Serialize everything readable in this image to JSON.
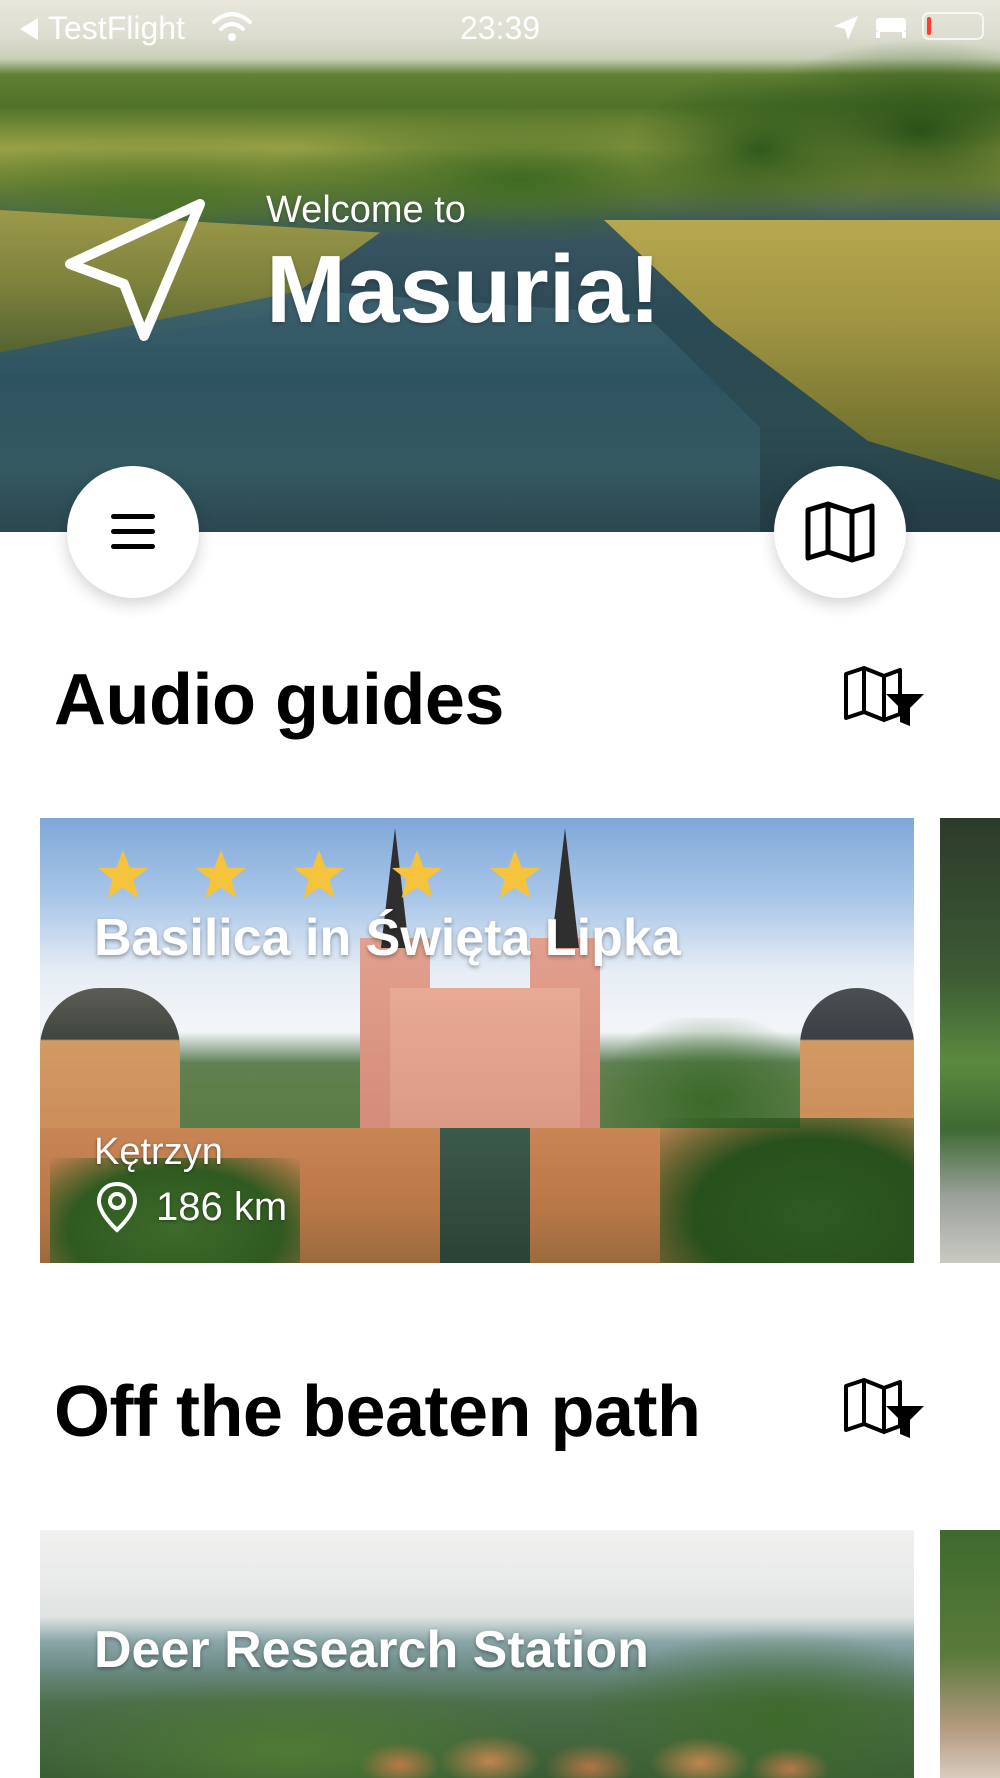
{
  "status_bar": {
    "back_app": "TestFlight",
    "time": "23:39"
  },
  "hero": {
    "welcome": "Welcome to",
    "title": "Masuria!"
  },
  "sections": [
    {
      "title": "Audio guides",
      "cards": [
        {
          "title": "Basilica in Święta Lipka",
          "rating": 5,
          "city": "Kętrzyn",
          "distance": "186 km"
        }
      ]
    },
    {
      "title": "Off the beaten path",
      "cards": [
        {
          "title": "Deer Research Station"
        }
      ]
    }
  ],
  "icons": {
    "navigation": "navigation-arrow-icon",
    "menu": "hamburger-menu-icon",
    "map": "map-icon",
    "map_filter": "map-filter-icon",
    "star": "star-icon",
    "pin": "location-pin-icon"
  },
  "colors": {
    "star": "#F6C33D",
    "title": "#000000",
    "hero_text": "#FFFFFF"
  }
}
